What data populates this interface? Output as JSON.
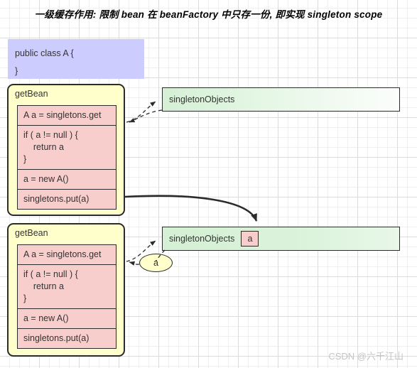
{
  "title": "一级缓存作用: 限制 bean 在 beanFactory 中只存一份, 即实现 singleton scope",
  "class_box": {
    "line1": "public class A {",
    "line2": "}"
  },
  "getbean_blocks": [
    {
      "title": "getBean",
      "statements": [
        "A a = singletons.get",
        "if ( a != null ) {\n    return a\n}",
        "a = new A()",
        "singletons.put(a)"
      ]
    },
    {
      "title": "getBean",
      "statements": [
        "A a = singletons.get",
        "if ( a != null ) {\n    return a\n}",
        "a = new A()",
        "singletons.put(a)"
      ]
    }
  ],
  "singleton_maps": [
    {
      "label": "singletonObjects",
      "entry": ""
    },
    {
      "label": "singletonObjects",
      "entry": "a"
    }
  ],
  "return_node": {
    "label": "a"
  },
  "watermark": "CSDN @六千江山",
  "colors": {
    "class_box_fill": "#ccccff",
    "getbean_fill": "#ffffcc",
    "statement_fill": "#f8cecc",
    "map_fill": "#d5f0d5",
    "stroke": "#2b2b2b",
    "text": "#333333",
    "grid": "#dcdcdc",
    "watermark": "#c4c4c4"
  }
}
